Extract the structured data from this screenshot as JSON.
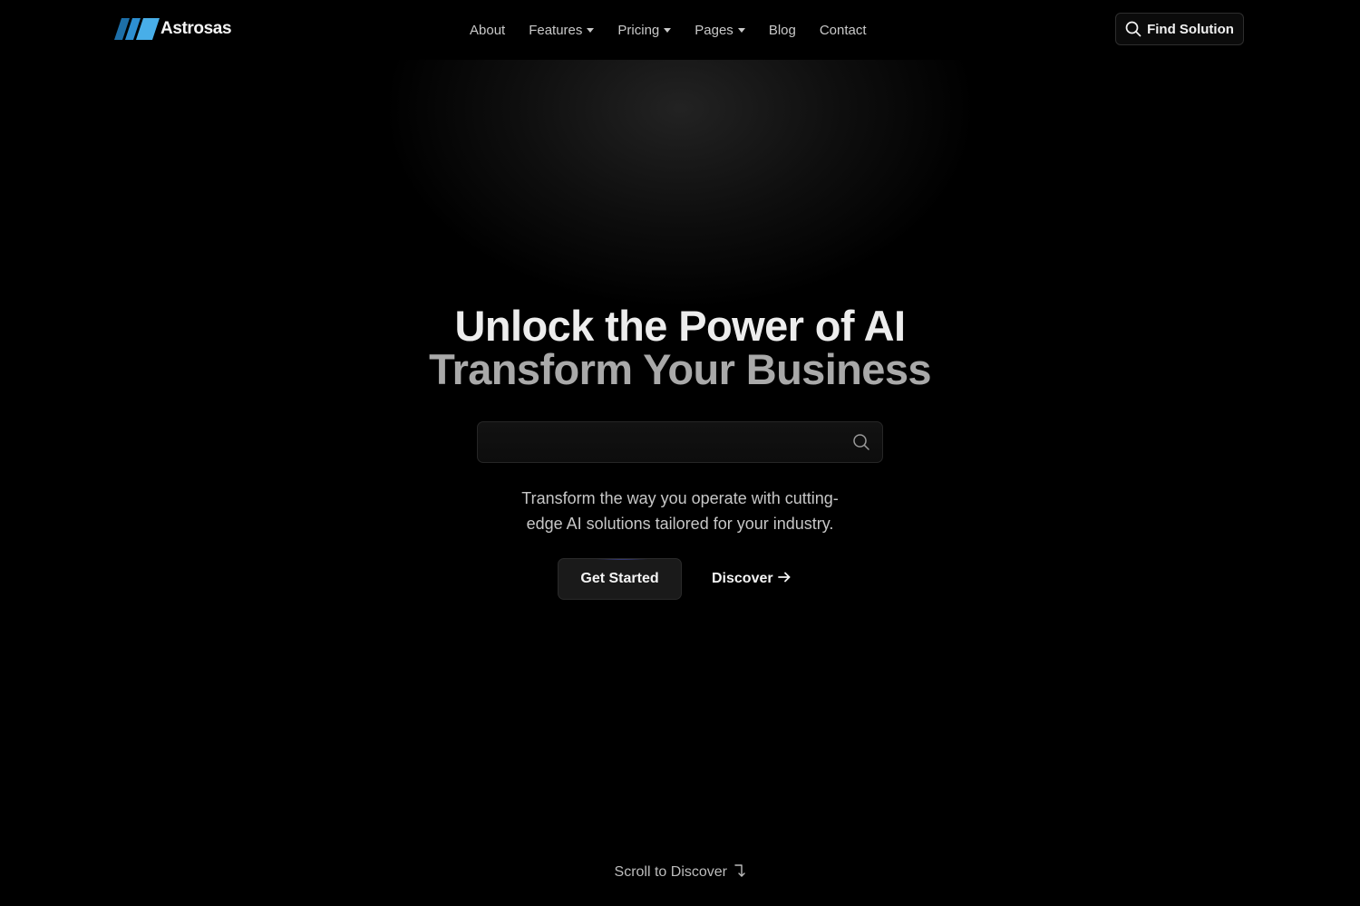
{
  "brand": {
    "name": "Astrosas",
    "mark_colors": [
      "#1d6fa8",
      "#2d8fd1",
      "#48aee8"
    ]
  },
  "nav": {
    "items": [
      {
        "label": "About",
        "has_dropdown": false
      },
      {
        "label": "Features",
        "has_dropdown": true
      },
      {
        "label": "Pricing",
        "has_dropdown": true
      },
      {
        "label": "Pages",
        "has_dropdown": true
      },
      {
        "label": "Blog",
        "has_dropdown": false
      },
      {
        "label": "Contact",
        "has_dropdown": false
      }
    ],
    "cta": {
      "label": "Find Solution",
      "icon": "search-icon"
    }
  },
  "hero": {
    "title_line1": "Unlock the Power of AI",
    "title_line2": "Transform Your Business",
    "search": {
      "value": "",
      "placeholder": "",
      "icon": "search-icon"
    },
    "subtitle": "Transform the way you operate with cutting-edge AI solutions tailored for your industry.",
    "primary_cta": "Get Started",
    "secondary_cta": "Discover",
    "secondary_cta_icon": "arrow-right-icon"
  },
  "scroll_hint": {
    "label": "Scroll to Discover",
    "icon": "corner-down-icon"
  },
  "colors": {
    "background": "#000000",
    "title_primary": "#ededed",
    "title_secondary": "#a9a9a9",
    "accent_glow": "#505adc"
  }
}
